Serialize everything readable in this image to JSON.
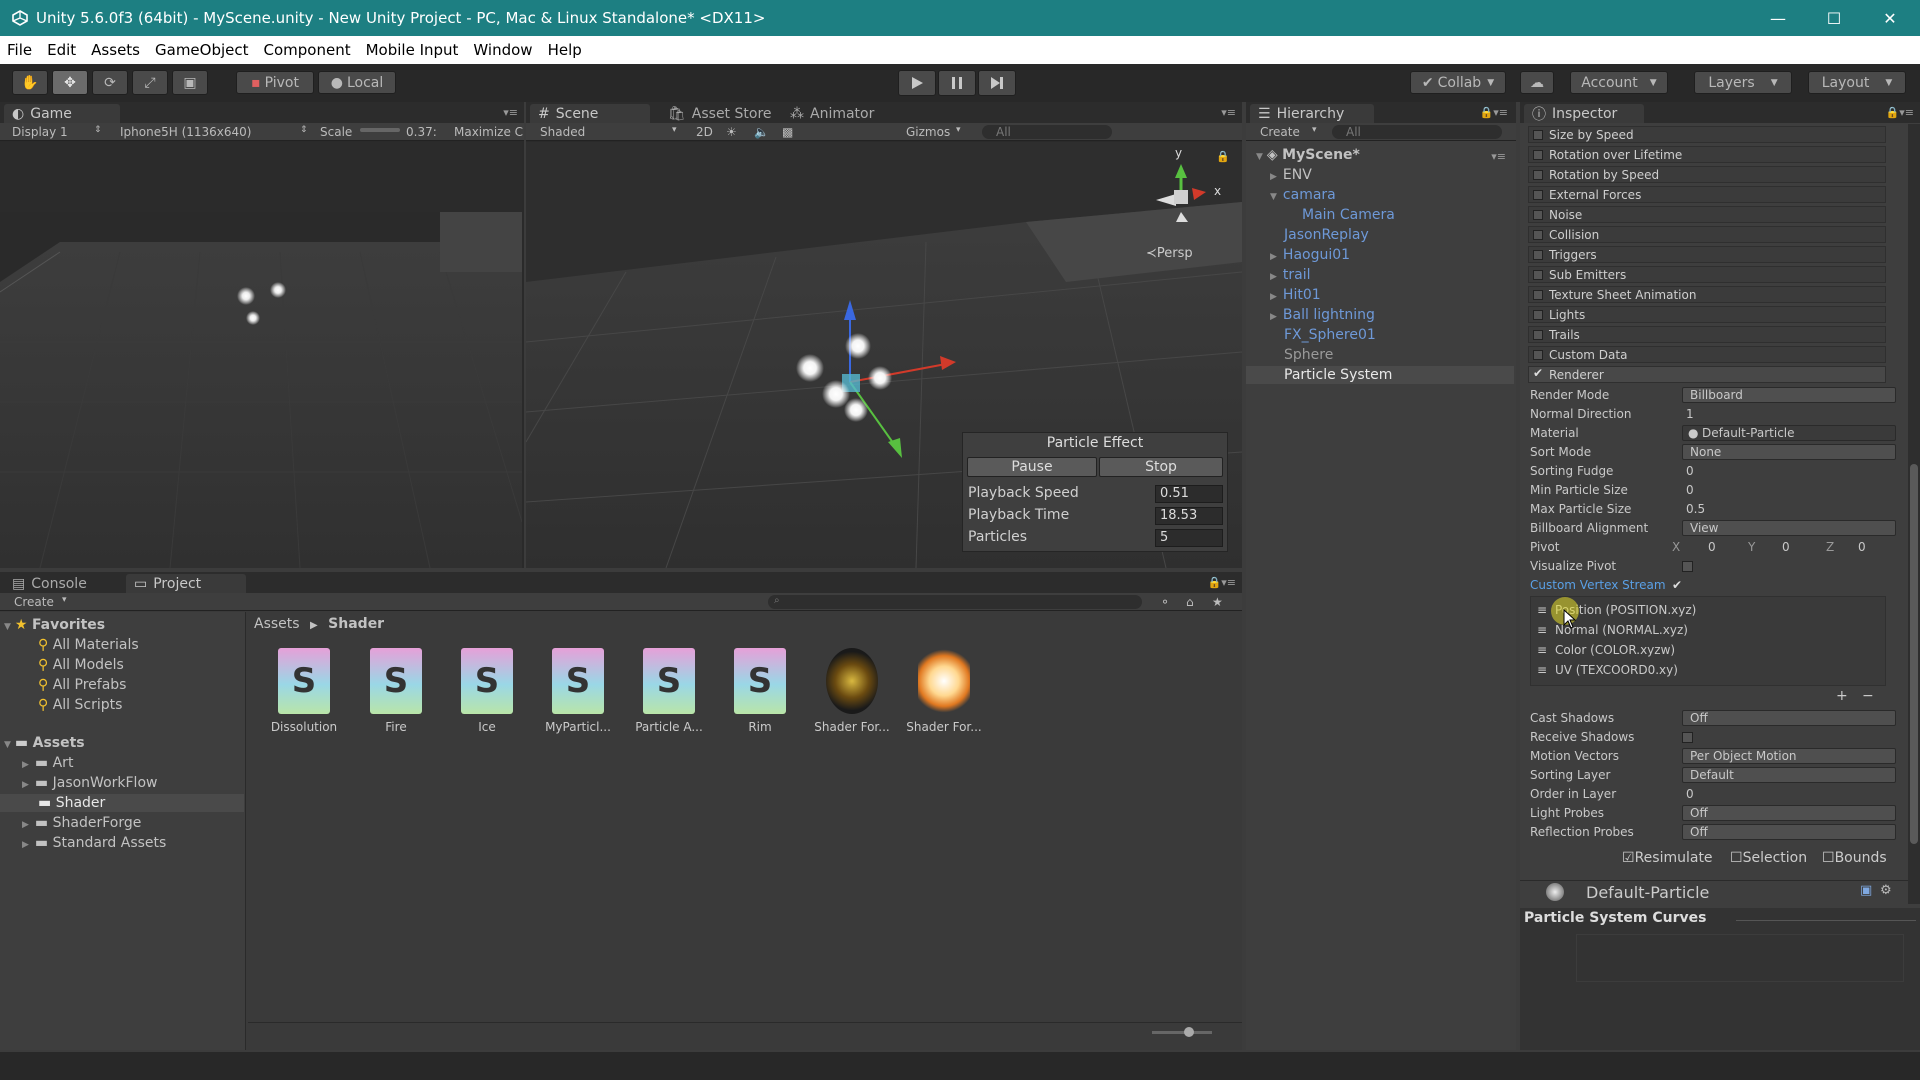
{
  "window": {
    "title": "Unity 5.6.0f3 (64bit) - MyScene.unity - New Unity Project - PC, Mac & Linux Standalone* <DX11>",
    "minimize": "—",
    "maximize": "☐",
    "close": "✕",
    "titlebar_color": "#1d7f82"
  },
  "menu": [
    "File",
    "Edit",
    "Assets",
    "GameObject",
    "Component",
    "Mobile Input",
    "Window",
    "Help"
  ],
  "toolbar": {
    "pivot": "Pivot",
    "local": "Local",
    "collab": "Collab",
    "account": "Account",
    "layers": "Layers",
    "layout": "Layout",
    "tools": [
      "hand-icon",
      "move-icon",
      "rotate-icon",
      "scale-icon",
      "rect-icon"
    ],
    "play_icons": [
      "play-icon",
      "pause-icon",
      "step-icon"
    ]
  },
  "game": {
    "tab": "Game",
    "display": "Display 1",
    "resolution": "Iphone5H (1136x640)",
    "scale_label": "Scale",
    "scale_value": "0.37:",
    "maximize": "Maximize C"
  },
  "scene": {
    "tabs": [
      "Scene",
      "Asset Store",
      "Animator"
    ],
    "shading": "Shaded",
    "mode2d": "2D",
    "gizmos": "Gizmos",
    "search_placeholder": "All",
    "persp": "Persp",
    "axis_y": "y",
    "axis_x": "x"
  },
  "particle_effect": {
    "title": "Particle Effect",
    "pause": "Pause",
    "stop": "Stop",
    "rows": [
      {
        "label": "Playback Speed",
        "value": "0.51"
      },
      {
        "label": "Playback Time",
        "value": "18.53"
      },
      {
        "label": "Particles",
        "value": "5"
      }
    ]
  },
  "hierarchy": {
    "tab": "Hierarchy",
    "create": "Create",
    "search_placeholder": "All",
    "scene_name": "MyScene*",
    "items": [
      "ENV",
      "camara",
      "Main Camera",
      "JasonReplay",
      "Haogui01",
      "trail",
      "Hit01",
      "Ball lightning",
      "FX_Sphere01",
      "Sphere",
      "Particle System"
    ]
  },
  "inspector": {
    "tab": "Inspector",
    "modules": [
      "Size by Speed",
      "Rotation over Lifetime",
      "Rotation by Speed",
      "External Forces",
      "Noise",
      "Collision",
      "Triggers",
      "Sub Emitters",
      "Texture Sheet Animation",
      "Lights",
      "Trails",
      "Custom Data",
      "Renderer"
    ],
    "renderer_rows": [
      {
        "label": "Render Mode",
        "value": "Billboard"
      },
      {
        "label": "Normal Direction",
        "value": "1"
      },
      {
        "label": "Material",
        "value": "Default-Particle"
      },
      {
        "label": "Sort Mode",
        "value": "None"
      },
      {
        "label": "Sorting Fudge",
        "value": "0"
      },
      {
        "label": "Min Particle Size",
        "value": "0"
      },
      {
        "label": "Max Particle Size",
        "value": "0.5"
      },
      {
        "label": "Billboard Alignment",
        "value": "View"
      }
    ],
    "pivot": {
      "label": "Pivot",
      "x_label": "X",
      "x": "0",
      "y_label": "Y",
      "y": "0",
      "z_label": "Z",
      "z": "0"
    },
    "visualize_pivot": "Visualize Pivot",
    "custom_vertex_streams": "Custom Vertex Stream",
    "streams": [
      "Position (POSITION.xyz)",
      "Normal (NORMAL.xyz)",
      "Color (COLOR.xyzw)",
      "UV (TEXCOORD0.xy)"
    ],
    "plus": "+",
    "minus": "−",
    "bottom_rows": [
      {
        "label": "Cast Shadows",
        "value": "Off"
      },
      {
        "label": "Receive Shadows",
        "value": ""
      },
      {
        "label": "Motion Vectors",
        "value": "Per Object Motion"
      },
      {
        "label": "Sorting Layer",
        "value": "Default"
      },
      {
        "label": "Order in Layer",
        "value": "0"
      },
      {
        "label": "Light Probes",
        "value": "Off"
      },
      {
        "label": "Reflection Probes",
        "value": "Off"
      }
    ],
    "resimulate": "Resimulate",
    "selection": "Selection",
    "bounds": "Bounds",
    "material_name": "Default-Particle",
    "curves_title": "Particle System Curves"
  },
  "console_tab": "Console",
  "project": {
    "tab": "Project",
    "create": "Create",
    "favorites": "Favorites",
    "favorite_items": [
      "All Materials",
      "All Models",
      "All Prefabs",
      "All Scripts"
    ],
    "assets": "Assets",
    "folders": [
      "Art",
      "JasonWorkFlow",
      "Shader",
      "ShaderForge",
      "Standard Assets"
    ],
    "breadcrumb_root": "Assets",
    "breadcrumb_current": "Shader",
    "asset_items": [
      "Dissolution",
      "Fire",
      "Ice",
      "MyParticl...",
      "Particle A...",
      "Rim",
      "Shader For...",
      "Shader For..."
    ]
  }
}
